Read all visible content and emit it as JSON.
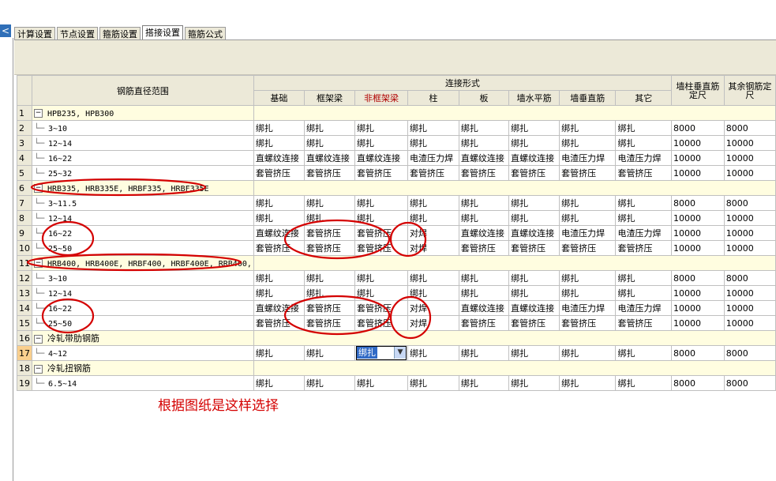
{
  "tabs": [
    "计算设置",
    "节点设置",
    "箍筋设置",
    "搭接设置",
    "箍筋公式"
  ],
  "active_tab": 3,
  "left_button": "<",
  "headers": {
    "range": "钢筋直径范围",
    "connection_group": "连接形式",
    "columns": [
      "基础",
      "框架梁",
      "非框架梁",
      "柱",
      "板",
      "墙水平筋",
      "墙垂直筋",
      "其它"
    ],
    "wall_col_fixed": "墙柱垂直筋定尺",
    "other_fixed": "其余钢筋定尺"
  },
  "highlight_column": 2,
  "rows": [
    {
      "n": "1",
      "type": "group",
      "label": "HPB235, HPB300"
    },
    {
      "n": "2",
      "type": "item",
      "label": "3~10",
      "vals": [
        "绑扎",
        "绑扎",
        "绑扎",
        "绑扎",
        "绑扎",
        "绑扎",
        "绑扎",
        "绑扎"
      ],
      "f1": "8000",
      "f2": "8000"
    },
    {
      "n": "3",
      "type": "item",
      "label": "12~14",
      "vals": [
        "绑扎",
        "绑扎",
        "绑扎",
        "绑扎",
        "绑扎",
        "绑扎",
        "绑扎",
        "绑扎"
      ],
      "f1": "10000",
      "f2": "10000"
    },
    {
      "n": "4",
      "type": "item",
      "label": "16~22",
      "vals": [
        "直螺纹连接",
        "直螺纹连接",
        "直螺纹连接",
        "电渣压力焊",
        "直螺纹连接",
        "直螺纹连接",
        "电渣压力焊",
        "电渣压力焊"
      ],
      "f1": "10000",
      "f2": "10000"
    },
    {
      "n": "5",
      "type": "item",
      "label": "25~32",
      "vals": [
        "套管挤压",
        "套管挤压",
        "套管挤压",
        "套管挤压",
        "套管挤压",
        "套管挤压",
        "套管挤压",
        "套管挤压"
      ],
      "f1": "10000",
      "f2": "10000"
    },
    {
      "n": "6",
      "type": "group",
      "label": "HRB335, HRB335E, HRBF335, HRBF335E"
    },
    {
      "n": "7",
      "type": "item",
      "label": "3~11.5",
      "vals": [
        "绑扎",
        "绑扎",
        "绑扎",
        "绑扎",
        "绑扎",
        "绑扎",
        "绑扎",
        "绑扎"
      ],
      "f1": "8000",
      "f2": "8000"
    },
    {
      "n": "8",
      "type": "item",
      "label": "12~14",
      "vals": [
        "绑扎",
        "绑扎",
        "绑扎",
        "绑扎",
        "绑扎",
        "绑扎",
        "绑扎",
        "绑扎"
      ],
      "f1": "10000",
      "f2": "10000"
    },
    {
      "n": "9",
      "type": "item",
      "label": "16~22",
      "vals": [
        "直螺纹连接",
        "套管挤压",
        "套管挤压",
        "对焊",
        "直螺纹连接",
        "直螺纹连接",
        "电渣压力焊",
        "电渣压力焊"
      ],
      "f1": "10000",
      "f2": "10000"
    },
    {
      "n": "10",
      "type": "item",
      "label": "25~50",
      "vals": [
        "套管挤压",
        "套管挤压",
        "套管挤压",
        "对焊",
        "套管挤压",
        "套管挤压",
        "套管挤压",
        "套管挤压"
      ],
      "f1": "10000",
      "f2": "10000"
    },
    {
      "n": "11",
      "type": "group",
      "label": "HRB400, HRB400E, HRBF400, HRBF400E, RRB400,"
    },
    {
      "n": "12",
      "type": "item",
      "label": "3~10",
      "vals": [
        "绑扎",
        "绑扎",
        "绑扎",
        "绑扎",
        "绑扎",
        "绑扎",
        "绑扎",
        "绑扎"
      ],
      "f1": "8000",
      "f2": "8000"
    },
    {
      "n": "13",
      "type": "item",
      "label": "12~14",
      "vals": [
        "绑扎",
        "绑扎",
        "绑扎",
        "绑扎",
        "绑扎",
        "绑扎",
        "绑扎",
        "绑扎"
      ],
      "f1": "10000",
      "f2": "10000"
    },
    {
      "n": "14",
      "type": "item",
      "label": "16~22",
      "vals": [
        "直螺纹连接",
        "套管挤压",
        "套管挤压",
        "对焊",
        "直螺纹连接",
        "直螺纹连接",
        "电渣压力焊",
        "电渣压力焊"
      ],
      "f1": "10000",
      "f2": "10000"
    },
    {
      "n": "15",
      "type": "item",
      "label": "25~50",
      "vals": [
        "套管挤压",
        "套管挤压",
        "套管挤压",
        "对焊",
        "套管挤压",
        "套管挤压",
        "套管挤压",
        "套管挤压"
      ],
      "f1": "10000",
      "f2": "10000"
    },
    {
      "n": "16",
      "type": "group",
      "label": "冷轧带肋钢筋"
    },
    {
      "n": "17",
      "type": "item",
      "label": "4~12",
      "vals": [
        "绑扎",
        "绑扎",
        "绑扎",
        "绑扎",
        "绑扎",
        "绑扎",
        "绑扎",
        "绑扎"
      ],
      "f1": "8000",
      "f2": "8000",
      "selected": true,
      "combo_col": 2
    },
    {
      "n": "18",
      "type": "group",
      "label": "冷轧扭钢筋"
    },
    {
      "n": "19",
      "type": "item",
      "label": "6.5~14",
      "vals": [
        "绑扎",
        "绑扎",
        "绑扎",
        "绑扎",
        "绑扎",
        "绑扎",
        "绑扎",
        "绑扎"
      ],
      "f1": "8000",
      "f2": "8000"
    }
  ],
  "caption": "根据图纸是这样选择",
  "annotation_color": "#d40000"
}
